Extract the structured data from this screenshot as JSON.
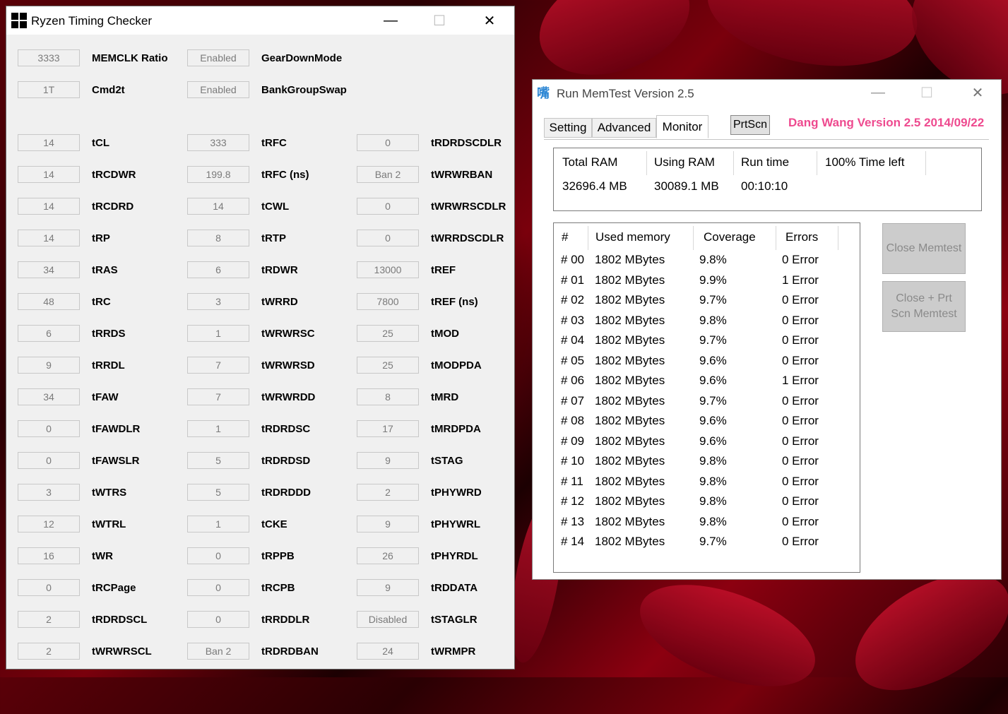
{
  "rtc": {
    "title": "Ryzen Timing Checker",
    "controls": {
      "minimize": "—",
      "maximize": "☐",
      "close": "✕"
    },
    "top_rows": [
      [
        {
          "value": "3333",
          "label": "MEMCLK Ratio"
        },
        {
          "value": "Enabled",
          "label": "GearDownMode"
        }
      ],
      [
        {
          "value": "1T",
          "label": "Cmd2t"
        },
        {
          "value": "Enabled",
          "label": "BankGroupSwap"
        }
      ]
    ],
    "rows": [
      [
        {
          "value": "14",
          "label": "tCL"
        },
        {
          "value": "333",
          "label": "tRFC"
        },
        {
          "value": "0",
          "label": "tRDRDSCDLR"
        }
      ],
      [
        {
          "value": "14",
          "label": "tRCDWR"
        },
        {
          "value": "199.8",
          "label": "tRFC (ns)"
        },
        {
          "value": "Ban 2",
          "label": "tWRWRBAN"
        }
      ],
      [
        {
          "value": "14",
          "label": "tRCDRD"
        },
        {
          "value": "14",
          "label": "tCWL"
        },
        {
          "value": "0",
          "label": "tWRWRSCDLR"
        }
      ],
      [
        {
          "value": "14",
          "label": "tRP"
        },
        {
          "value": "8",
          "label": "tRTP"
        },
        {
          "value": "0",
          "label": "tWRRDSCDLR"
        }
      ],
      [
        {
          "value": "34",
          "label": "tRAS"
        },
        {
          "value": "6",
          "label": "tRDWR"
        },
        {
          "value": "13000",
          "label": "tREF"
        }
      ],
      [
        {
          "value": "48",
          "label": "tRC"
        },
        {
          "value": "3",
          "label": "tWRRD"
        },
        {
          "value": "7800",
          "label": "tREF (ns)"
        }
      ],
      [
        {
          "value": "6",
          "label": "tRRDS"
        },
        {
          "value": "1",
          "label": "tWRWRSC"
        },
        {
          "value": "25",
          "label": "tMOD"
        }
      ],
      [
        {
          "value": "9",
          "label": "tRRDL"
        },
        {
          "value": "7",
          "label": "tWRWRSD"
        },
        {
          "value": "25",
          "label": "tMODPDA"
        }
      ],
      [
        {
          "value": "34",
          "label": "tFAW"
        },
        {
          "value": "7",
          "label": "tWRWRDD"
        },
        {
          "value": "8",
          "label": "tMRD"
        }
      ],
      [
        {
          "value": "0",
          "label": "tFAWDLR"
        },
        {
          "value": "1",
          "label": "tRDRDSC"
        },
        {
          "value": "17",
          "label": "tMRDPDA"
        }
      ],
      [
        {
          "value": "0",
          "label": "tFAWSLR"
        },
        {
          "value": "5",
          "label": "tRDRDSD"
        },
        {
          "value": "9",
          "label": "tSTAG"
        }
      ],
      [
        {
          "value": "3",
          "label": "tWTRS"
        },
        {
          "value": "5",
          "label": "tRDRDDD"
        },
        {
          "value": "2",
          "label": "tPHYWRD"
        }
      ],
      [
        {
          "value": "12",
          "label": "tWTRL"
        },
        {
          "value": "1",
          "label": "tCKE"
        },
        {
          "value": "9",
          "label": "tPHYWRL"
        }
      ],
      [
        {
          "value": "16",
          "label": "tWR"
        },
        {
          "value": "0",
          "label": "tRPPB"
        },
        {
          "value": "26",
          "label": "tPHYRDL"
        }
      ],
      [
        {
          "value": "0",
          "label": "tRCPage"
        },
        {
          "value": "0",
          "label": "tRCPB"
        },
        {
          "value": "9",
          "label": "tRDDATA"
        }
      ],
      [
        {
          "value": "2",
          "label": "tRDRDSCL"
        },
        {
          "value": "0",
          "label": "tRRDDLR"
        },
        {
          "value": "Disabled",
          "label": "tSTAGLR"
        }
      ],
      [
        {
          "value": "2",
          "label": "tWRWRSCL"
        },
        {
          "value": "Ban 2",
          "label": "tRDRDBAN"
        },
        {
          "value": "24",
          "label": "tWRMPR"
        }
      ]
    ]
  },
  "memtest": {
    "title": "Run MemTest Version 2.5",
    "icon_glyph": "嘴",
    "controls": {
      "minimize": "—",
      "maximize": "☐",
      "close": "✕"
    },
    "tabs": [
      "Setting",
      "Advanced",
      "Monitor"
    ],
    "active_tab": "Monitor",
    "prtscn": "PrtScn",
    "version": "Dang Wang Version 2.5 2014/09/22",
    "summary": {
      "headers": [
        "Total RAM",
        "Using RAM",
        "Run time",
        "100% Time left"
      ],
      "values": [
        "32696.4 MB",
        "30089.1 MB",
        "00:10:10",
        ""
      ]
    },
    "list": {
      "headers": [
        "#",
        "Used memory",
        "Coverage",
        "Errors"
      ],
      "rows": [
        [
          "# 00",
          "1802 MBytes",
          "9.8%",
          "0 Error"
        ],
        [
          "# 01",
          "1802 MBytes",
          "9.9%",
          "1 Error"
        ],
        [
          "# 02",
          "1802 MBytes",
          "9.7%",
          "0 Error"
        ],
        [
          "# 03",
          "1802 MBytes",
          "9.8%",
          "0 Error"
        ],
        [
          "# 04",
          "1802 MBytes",
          "9.7%",
          "0 Error"
        ],
        [
          "# 05",
          "1802 MBytes",
          "9.6%",
          "0 Error"
        ],
        [
          "# 06",
          "1802 MBytes",
          "9.6%",
          "1 Error"
        ],
        [
          "# 07",
          "1802 MBytes",
          "9.7%",
          "0 Error"
        ],
        [
          "# 08",
          "1802 MBytes",
          "9.6%",
          "0 Error"
        ],
        [
          "# 09",
          "1802 MBytes",
          "9.6%",
          "0 Error"
        ],
        [
          "# 10",
          "1802 MBytes",
          "9.8%",
          "0 Error"
        ],
        [
          "# 11",
          "1802 MBytes",
          "9.8%",
          "0 Error"
        ],
        [
          "# 12",
          "1802 MBytes",
          "9.8%",
          "0 Error"
        ],
        [
          "# 13",
          "1802 MBytes",
          "9.8%",
          "0 Error"
        ],
        [
          "# 14",
          "1802 MBytes",
          "9.7%",
          "0 Error"
        ]
      ]
    },
    "buttons": {
      "close": "Close Memtest",
      "close_prt": "Close +    Prt Scn Memtest"
    }
  }
}
